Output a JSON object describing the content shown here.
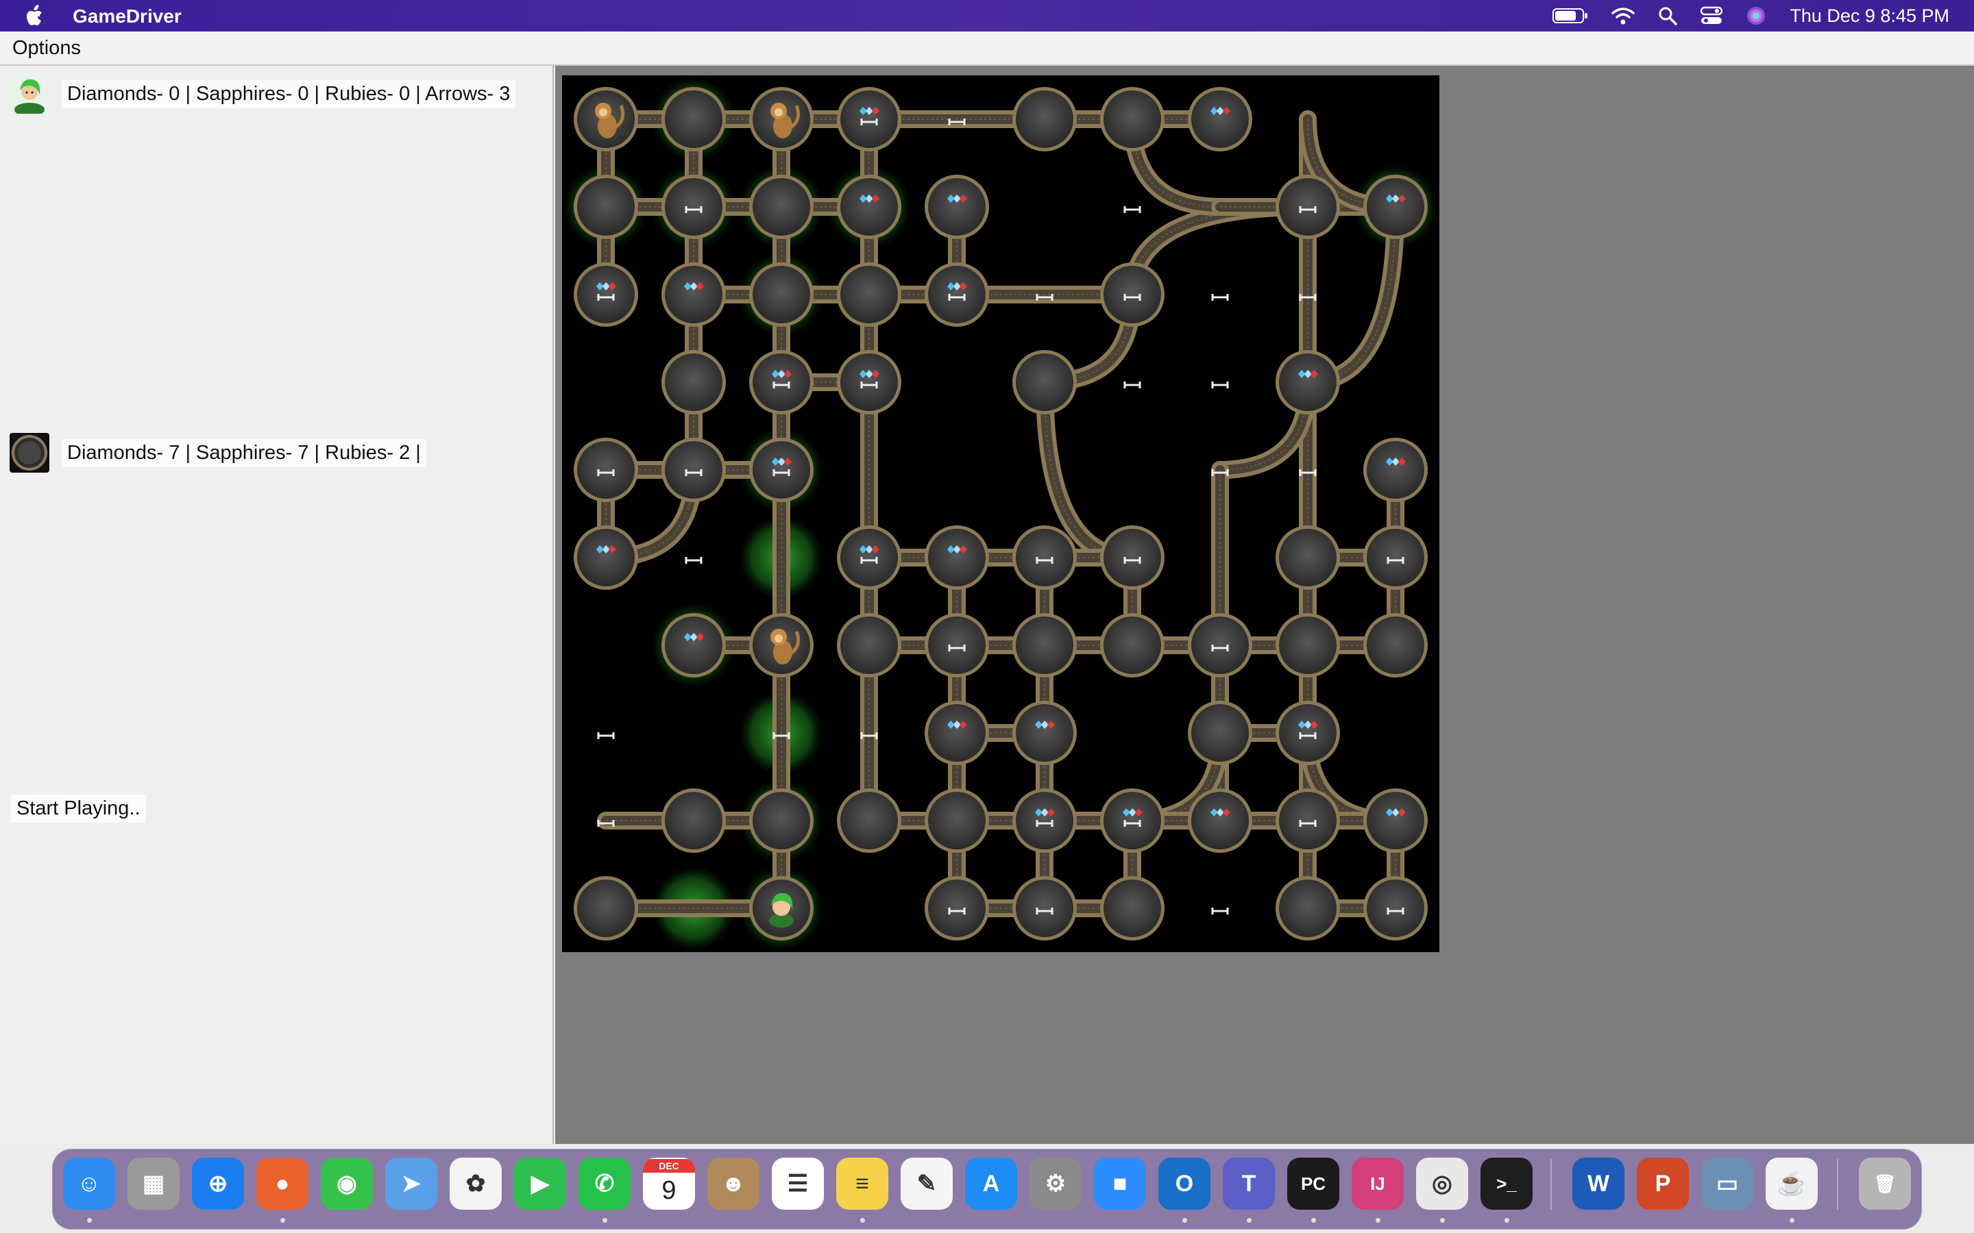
{
  "menubar": {
    "app_name": "GameDriver",
    "clock": "Thu Dec 9  8:45 PM",
    "icons": [
      "apple-icon",
      "battery-icon",
      "wifi-icon",
      "spotlight-icon",
      "control-center-icon",
      "siri-icon"
    ]
  },
  "app_menu": {
    "options_label": "Options"
  },
  "left_panel": {
    "player_stats": "Diamonds- 0 | Sapphires- 0 | Rubies- 0 | Arrows- 3",
    "pit_stats": "Diamonds- 7 | Sapphires- 7 | Rubies- 2 |",
    "status_message": "Start Playing.."
  },
  "board": {
    "grid_size": 10,
    "entities": {
      "monkey": "monkey-icon",
      "player": "player-icon",
      "gems": "gem-icon",
      "arrow": "arrow-icon"
    }
  },
  "dock": {
    "apps": [
      {
        "name": "finder-icon",
        "color": "#2f8cf0",
        "glyph": "☺"
      },
      {
        "name": "launchpad-icon",
        "color": "#9a9a9a",
        "glyph": "▦"
      },
      {
        "name": "safari-icon",
        "color": "#1a7ef0",
        "glyph": "⊕"
      },
      {
        "name": "firefox-icon",
        "color": "#e8602c",
        "glyph": "●"
      },
      {
        "name": "messages-icon",
        "color": "#35c24b",
        "glyph": "◉"
      },
      {
        "name": "maps-icon",
        "color": "#5aa0e8",
        "glyph": "➤"
      },
      {
        "name": "photos-icon",
        "color": "#f4f4f4",
        "glyph": "✿"
      },
      {
        "name": "facetime-icon",
        "color": "#2cbf4e",
        "glyph": "▶"
      },
      {
        "name": "whatsapp-icon",
        "color": "#25c14b",
        "glyph": "✆"
      },
      {
        "name": "calendar-icon",
        "color": "#ffffff",
        "glyph": "9"
      },
      {
        "name": "contacts-icon",
        "color": "#b08a5c",
        "glyph": "☻"
      },
      {
        "name": "reminders-icon",
        "color": "#ffffff",
        "glyph": "☰"
      },
      {
        "name": "notes-icon",
        "color": "#f6d24a",
        "glyph": "≡"
      },
      {
        "name": "pages-icon",
        "color": "#f5f5f5",
        "glyph": "✎"
      },
      {
        "name": "app-store-icon",
        "color": "#1d8cf4",
        "glyph": "A"
      },
      {
        "name": "system-preferences-icon",
        "color": "#8a8a8a",
        "glyph": "⚙"
      },
      {
        "name": "zoom-icon",
        "color": "#2d8cff",
        "glyph": "■"
      },
      {
        "name": "outlook-icon",
        "color": "#1a6fc8",
        "glyph": "O"
      },
      {
        "name": "teams-icon",
        "color": "#5b5fc7",
        "glyph": "T"
      },
      {
        "name": "pycharm-icon",
        "color": "#1b1b1b",
        "glyph": "PC"
      },
      {
        "name": "intellij-icon",
        "color": "#d33f78",
        "glyph": "IJ"
      },
      {
        "name": "chrome-icon",
        "color": "#e8e8e8",
        "glyph": "◎"
      },
      {
        "name": "terminal-icon",
        "color": "#1e1e1e",
        "glyph": ">_"
      },
      {
        "name": "word-icon",
        "color": "#1e5bb8",
        "glyph": "W"
      },
      {
        "name": "powerpoint-icon",
        "color": "#d24726",
        "glyph": "P"
      },
      {
        "name": "preview-icon",
        "color": "#6c8fb5",
        "glyph": "▭"
      },
      {
        "name": "java-app-icon",
        "color": "#f2f2f2",
        "glyph": "☕"
      },
      {
        "name": "trash-icon",
        "color": "#b5b5b5",
        "glyph": "🗑"
      }
    ],
    "calendar_month": "DEC",
    "calendar_day": "9"
  }
}
